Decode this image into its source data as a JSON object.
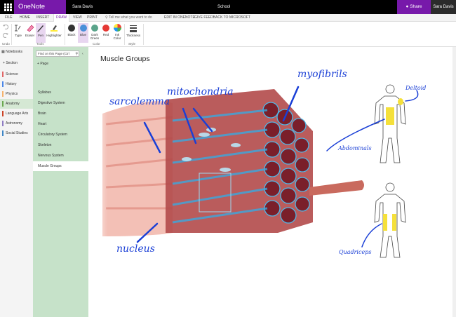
{
  "app": {
    "name": "OneNote Online",
    "user": "Sara Davis",
    "notebook": "School",
    "share_label": "Share"
  },
  "tabs": [
    "FILE",
    "HOME",
    "INSERT",
    "DRAW",
    "VIEW",
    "PRINT"
  ],
  "tell_me": "Tell me what you want to do",
  "edit_in_onenote": "EDIT IN ONENOTE",
  "feedback": "GIVE FEEDBACK TO MICROSOFT",
  "ribbon": {
    "undo_group": "Undo",
    "tools_group": "Tools",
    "color_group": "Color",
    "style_group": "Style",
    "type": "Type",
    "eraser": "Eraser",
    "pen": "Pen",
    "highlighter": "Highlighter",
    "black": "Black",
    "blue": "Blue",
    "dark_green": "Dark Green",
    "red": "Red",
    "ink_color": "Ink Color",
    "thickness": "Thickness"
  },
  "colors": {
    "brand": "#7719aa",
    "black": "#333333",
    "blue": "#4a90d9",
    "dark_green": "#5aa48a",
    "red": "#e53935"
  },
  "notebooks": {
    "header": "Notebooks",
    "add_section": "Section",
    "sections": [
      {
        "label": "Science",
        "color": "#e06666"
      },
      {
        "label": "History",
        "color": "#4a86e8"
      },
      {
        "label": "Physics",
        "color": "#f6b26b"
      },
      {
        "label": "Anatomy",
        "color": "#6aa84f"
      },
      {
        "label": "Language Arts",
        "color": "#cc4125"
      },
      {
        "label": "Astronomy",
        "color": "#8e7cc3"
      },
      {
        "label": "Social Studies",
        "color": "#3d85c6"
      }
    ]
  },
  "pages": {
    "find_placeholder": "Find on this Page (Ctrl",
    "add_page": "Page",
    "items": [
      "Syllabus",
      "Digestive System",
      "Brain",
      "Heart",
      "Circulatory System",
      "Skeleton",
      "Nervous System",
      "Muscle Groups"
    ]
  },
  "page_title": "Muscle Groups",
  "ink_labels": {
    "sarcolemma": "sarcolemma",
    "mitochondria": "mitochondria",
    "myofibrils": "myofibrils",
    "nucleus": "nucleus",
    "deltoid": "Deltoid",
    "abdominals": "Abdominals",
    "quadriceps": "Quadriceps"
  }
}
